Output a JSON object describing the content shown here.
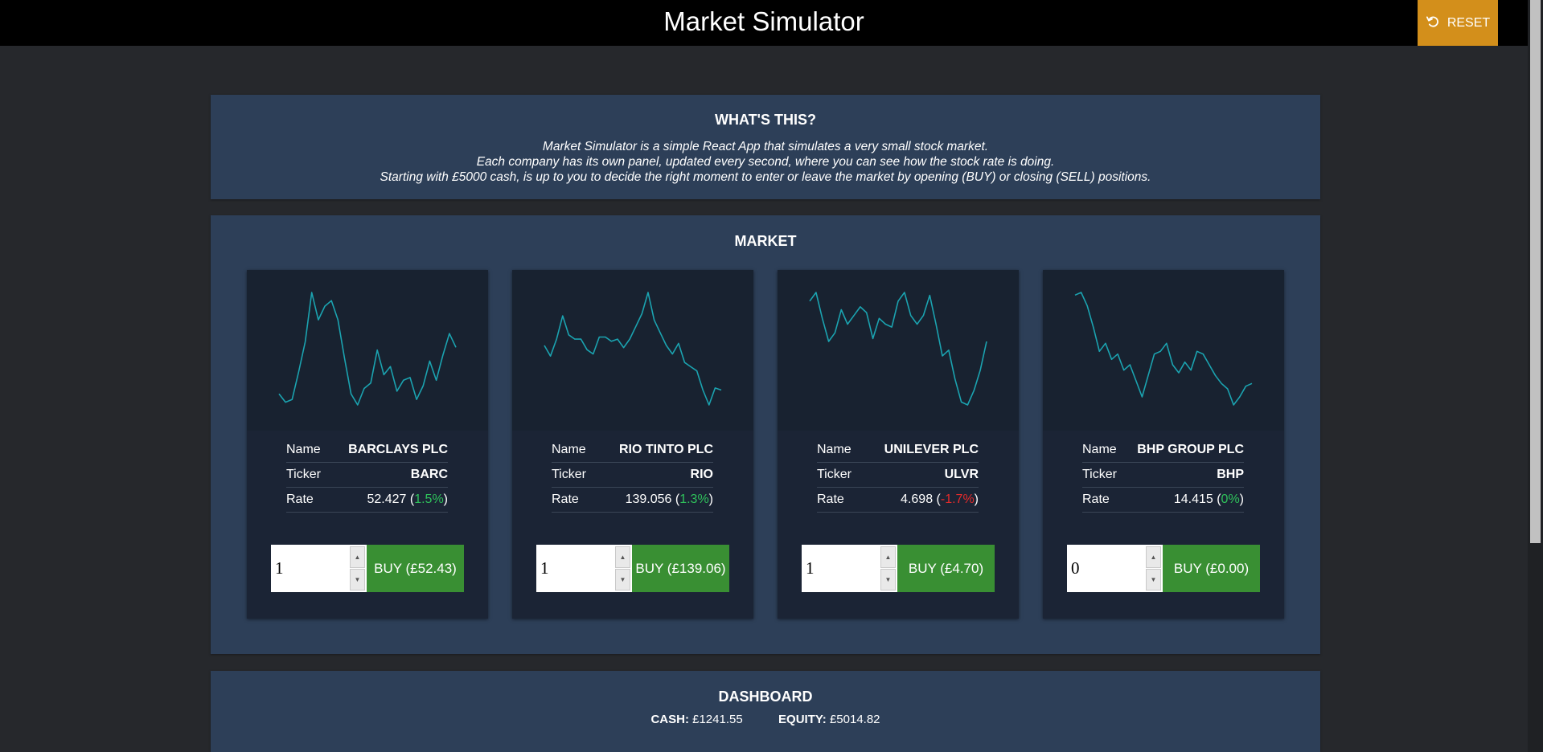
{
  "app": {
    "title": "Market Simulator",
    "reset_label": "RESET",
    "reset_icon": "refresh-icon"
  },
  "intro": {
    "title": "WHAT'S THIS?",
    "lines": [
      "Market Simulator is a simple React App that simulates a very small stock market.",
      "Each company has its own panel, updated every second, where you can see how the stock rate is doing.",
      "Starting with £5000 cash, is up to you to decide the right moment to enter or leave the market by opening (BUY) or closing (SELL) positions."
    ]
  },
  "market": {
    "title": "MARKET",
    "labels": {
      "name": "Name",
      "ticker": "Ticker",
      "rate": "Rate"
    },
    "line_color": "#1ba3b0",
    "stocks": [
      {
        "name": "BARCLAYS PLC",
        "ticker": "BARC",
        "rate": "52.427",
        "change": "1.5%",
        "change_sign": "pos",
        "quantity": "1",
        "buy_label": "BUY (£52.43)",
        "series": [
          50.9,
          50.6,
          50.7,
          51.7,
          52.8,
          54.6,
          53.6,
          54.1,
          54.3,
          53.6,
          52.2,
          50.9,
          50.5,
          51.1,
          51.3,
          52.5,
          51.6,
          51.9,
          51.0,
          51.4,
          51.5,
          50.7,
          51.2,
          52.1,
          51.4,
          52.3,
          53.1,
          52.6
        ]
      },
      {
        "name": "RIO TINTO PLC",
        "ticker": "RIO",
        "rate": "139.056",
        "change": "1.3%",
        "change_sign": "pos",
        "quantity": "1",
        "buy_label": "BUY (£139.06)",
        "series": [
          139.4,
          138.9,
          139.7,
          140.8,
          139.9,
          139.7,
          139.7,
          139.2,
          139.0,
          139.8,
          139.8,
          139.6,
          139.7,
          139.3,
          139.7,
          140.3,
          140.9,
          141.9,
          140.6,
          140.0,
          139.4,
          139.0,
          139.5,
          138.6,
          138.4,
          138.2,
          137.3,
          136.6,
          137.4,
          137.3
        ]
      },
      {
        "name": "UNILEVER PLC",
        "ticker": "ULVR",
        "rate": "4.698",
        "change": "-1.7%",
        "change_sign": "neg",
        "quantity": "1",
        "buy_label": "BUY (£4.70)",
        "series": [
          4.89,
          4.92,
          4.83,
          4.75,
          4.78,
          4.86,
          4.81,
          4.84,
          4.87,
          4.85,
          4.76,
          4.83,
          4.81,
          4.8,
          4.89,
          4.92,
          4.84,
          4.81,
          4.84,
          4.91,
          4.81,
          4.7,
          4.72,
          4.62,
          4.54,
          4.53,
          4.58,
          4.65,
          4.75
        ]
      },
      {
        "name": "BHP GROUP PLC",
        "ticker": "BHP",
        "rate": "14.415",
        "change": "0%",
        "change_sign": "pos",
        "quantity": "0",
        "buy_label": "BUY (£0.00)",
        "series": [
          14.85,
          14.86,
          14.81,
          14.73,
          14.64,
          14.67,
          14.61,
          14.63,
          14.57,
          14.59,
          14.53,
          14.47,
          14.55,
          14.63,
          14.64,
          14.67,
          14.59,
          14.56,
          14.6,
          14.57,
          14.64,
          14.63,
          14.59,
          14.55,
          14.52,
          14.5,
          14.44,
          14.47,
          14.51,
          14.52
        ]
      }
    ]
  },
  "dashboard": {
    "title": "DASHBOARD",
    "cash_label": "CASH:",
    "cash_value": "£1241.55",
    "equity_label": "EQUITY:",
    "equity_value": "£5014.82"
  }
}
